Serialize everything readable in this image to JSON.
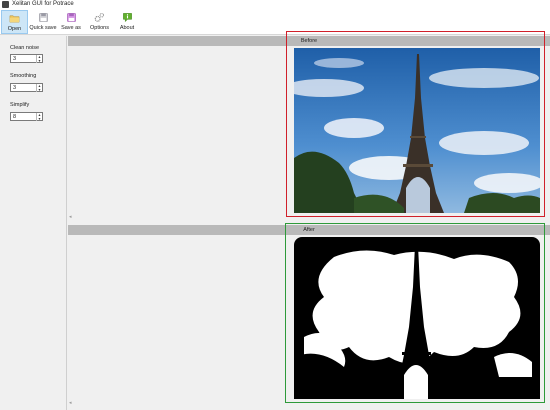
{
  "window": {
    "title": "Xelitan GUI for Potrace"
  },
  "toolbar": {
    "buttons": [
      {
        "label": "Open",
        "icon": "folder-icon"
      },
      {
        "label": "Quick save",
        "icon": "save-icon"
      },
      {
        "label": "Save as",
        "icon": "save-as-icon"
      },
      {
        "label": "Options",
        "icon": "gear-icon"
      },
      {
        "label": "About",
        "icon": "info-icon"
      }
    ]
  },
  "sidebar": {
    "clean_noise": {
      "label": "Clean noise",
      "value": "3"
    },
    "smoothing": {
      "label": "Smoothing",
      "value": "3"
    },
    "simplify": {
      "label": "Simplify",
      "value": "8"
    }
  },
  "panes": {
    "before": {
      "label": "Before"
    },
    "after": {
      "label": "After"
    }
  },
  "colors": {
    "before_frame": "#d0202a",
    "after_frame": "#2e9a3a",
    "active_button": "#cde6f7"
  }
}
